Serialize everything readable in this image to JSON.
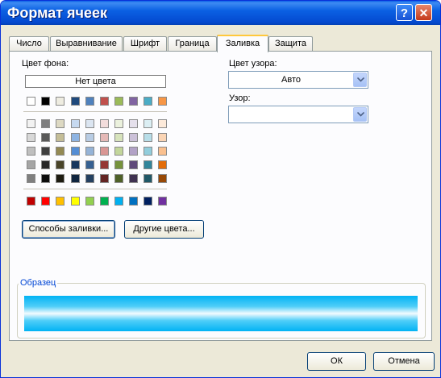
{
  "window": {
    "title": "Формат ячеек",
    "help_label": "?",
    "close_label": "✕"
  },
  "tabs": [
    {
      "label": "Число"
    },
    {
      "label": "Выравнивание"
    },
    {
      "label": "Шрифт"
    },
    {
      "label": "Граница"
    },
    {
      "label": "Заливка",
      "active": true
    },
    {
      "label": "Защита"
    }
  ],
  "fill": {
    "background_label": "Цвет фона:",
    "no_color_label": "Нет цвета",
    "pattern_color_label": "Цвет узора:",
    "pattern_color_value": "Авто",
    "pattern_style_label": "Узор:",
    "pattern_style_value": "",
    "fill_effects_button": "Способы заливки...",
    "more_colors_button": "Другие цвета...",
    "sample_label": "Образец"
  },
  "palette": {
    "theme_row": [
      "#ffffff",
      "#000000",
      "#eeece1",
      "#1f497d",
      "#4f81bd",
      "#c0504d",
      "#9bbb59",
      "#8064a2",
      "#4bacc6",
      "#f79646"
    ],
    "tints": [
      [
        "#f2f2f2",
        "#7f7f7f",
        "#ddd9c3",
        "#c6d9f0",
        "#dbe5f1",
        "#f2dcdb",
        "#ebf1dd",
        "#e5e0ec",
        "#dbeef3",
        "#fdeada"
      ],
      [
        "#d8d8d8",
        "#595959",
        "#c4bd97",
        "#8db3e2",
        "#b8cce4",
        "#e5b9b7",
        "#d7e3bc",
        "#ccc1d9",
        "#b7dde8",
        "#fbd5b5"
      ],
      [
        "#bfbfbf",
        "#3f3f3f",
        "#938953",
        "#548dd4",
        "#95b3d7",
        "#d99694",
        "#c3d69b",
        "#b2a2c7",
        "#92cddc",
        "#fac08f"
      ],
      [
        "#a5a5a5",
        "#262626",
        "#494429",
        "#17365d",
        "#366092",
        "#953734",
        "#76923c",
        "#5f497a",
        "#31859b",
        "#e36c09"
      ],
      [
        "#7f7f7f",
        "#0c0c0c",
        "#1d1b10",
        "#0f243e",
        "#244061",
        "#632423",
        "#4f6128",
        "#3f3151",
        "#205867",
        "#974806"
      ]
    ],
    "standard": [
      "#c00000",
      "#ff0000",
      "#ffc000",
      "#ffff00",
      "#92d050",
      "#00b050",
      "#00b0f0",
      "#0070c0",
      "#002060",
      "#7030a0"
    ]
  },
  "footer": {
    "ok_label": "ОК",
    "cancel_label": "Отмена"
  }
}
